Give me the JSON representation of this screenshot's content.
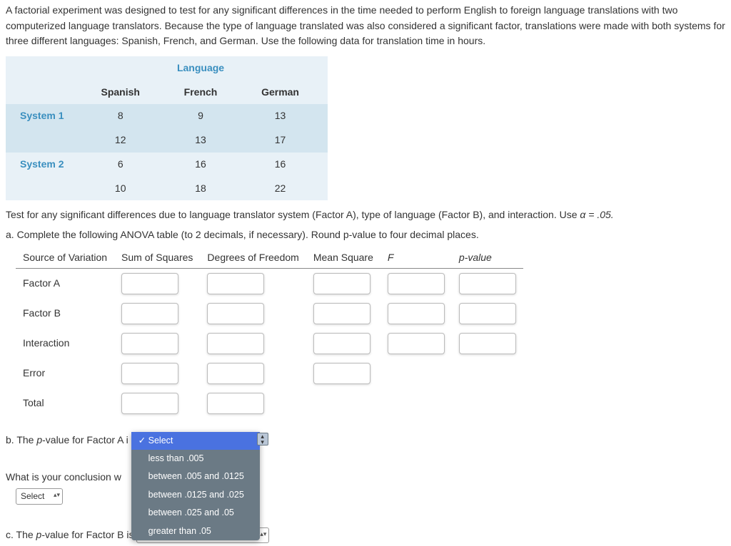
{
  "intro": "A factorial experiment was designed to test for any significant differences in the time needed to perform English to foreign language translations with two computerized language translators. Because the type of language translated was also considered a significant factor, translations were made with both systems for three different languages: Spanish, French, and German. Use the following data for translation time in hours.",
  "data_table": {
    "super_header": "Language",
    "columns": [
      "Spanish",
      "French",
      "German"
    ],
    "rows": [
      {
        "label": "System 1",
        "values": [
          "8",
          "9",
          "13"
        ]
      },
      {
        "label": "",
        "values": [
          "12",
          "13",
          "17"
        ]
      },
      {
        "label": "System 2",
        "values": [
          "6",
          "16",
          "16"
        ]
      },
      {
        "label": "",
        "values": [
          "10",
          "18",
          "22"
        ]
      }
    ]
  },
  "after_table": "Test for any significant differences due to language translator system (Factor A), type of language (Factor B), and interaction. Use ",
  "alpha_eq": "α = .05.",
  "part_a": "a. Complete the following ANOVA table (to 2 decimals, if necessary). Round p-value to four decimal places.",
  "anova_headers": [
    "Source of Variation",
    "Sum of Squares",
    "Degrees of Freedom",
    "Mean Square",
    "F",
    "p-value"
  ],
  "anova_rows": [
    "Factor A",
    "Factor B",
    "Interaction",
    "Error",
    "Total"
  ],
  "part_b_prefix": "b. The ",
  "pvalue_word": "p",
  "part_b_suffix": "-value for Factor A i",
  "dropdown_options": [
    "Select",
    "less than .005",
    "between .005 and .0125",
    "between .0125 and .025",
    "between .025 and .05",
    "greater than .05"
  ],
  "dropdown_selected": "Select",
  "conclusion_q": "What is your conclusion w",
  "select_label": "Select",
  "part_c_prefix": "c. The ",
  "part_c_suffix": "-value for Factor B is"
}
